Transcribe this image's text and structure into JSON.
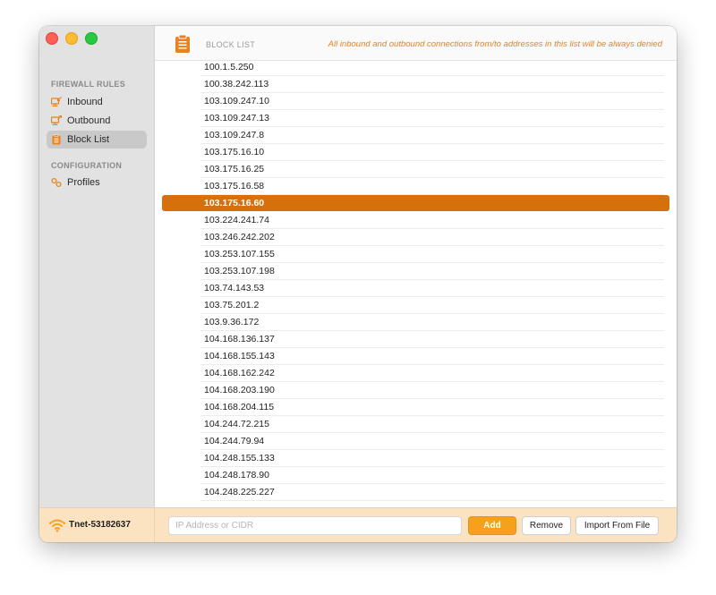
{
  "sidebar": {
    "sections": [
      {
        "title": "FIREWALL RULES",
        "items": [
          {
            "label": "Inbound",
            "icon": "inbound-icon"
          },
          {
            "label": "Outbound",
            "icon": "outbound-icon"
          },
          {
            "label": "Block List",
            "icon": "clipboard-icon",
            "selected": true
          }
        ]
      },
      {
        "title": "CONFIGURATION",
        "items": [
          {
            "label": "Profiles",
            "icon": "profiles-icon"
          }
        ]
      }
    ]
  },
  "header": {
    "icon": "clipboard-icon",
    "title": "BLOCK LIST",
    "description": "All inbound and outbound connections from/to addresses in this list will be always denied"
  },
  "block_list": {
    "selected_index": 8,
    "entries": [
      "100.1.5.250",
      "100.38.242.113",
      "103.109.247.10",
      "103.109.247.13",
      "103.109.247.8",
      "103.175.16.10",
      "103.175.16.25",
      "103.175.16.58",
      "103.175.16.60",
      "103.224.241.74",
      "103.246.242.202",
      "103.253.107.155",
      "103.253.107.198",
      "103.74.143.53",
      "103.75.201.2",
      "103.9.36.172",
      "104.168.136.137",
      "104.168.155.143",
      "104.168.162.242",
      "104.168.203.190",
      "104.168.204.115",
      "104.244.72.215",
      "104.244.79.94",
      "104.248.155.133",
      "104.248.178.90",
      "104.248.225.227"
    ]
  },
  "footer": {
    "network_icon": "wifi-icon",
    "network_name": "Tnet-53182637",
    "input": {
      "value": "",
      "placeholder": "IP Address or CIDR"
    },
    "add_label": "Add",
    "remove_label": "Remove",
    "import_label": "Import From File"
  },
  "colors": {
    "accent": "#f5a11d",
    "selection": "#d5700d",
    "header_text": "#e8821c",
    "footer_bg": "#fbe3c2"
  }
}
